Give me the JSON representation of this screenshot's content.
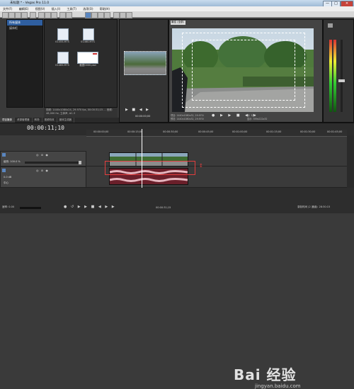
{
  "window": {
    "title": "未标题 * - Vegas Pro 11.0",
    "controls": [
      "—",
      "□",
      "✕"
    ]
  },
  "menu": [
    "文件(F)",
    "编辑(E)",
    "视图(V)",
    "插入(I)",
    "工具(T)",
    "选项(O)",
    "帮助(H)"
  ],
  "explorer": {
    "tree": [
      "所有媒体",
      "媒体柜"
    ],
    "files": [
      {
        "name": "01455.MTS"
      },
      {
        "name": "01460.MTS"
      },
      {
        "name": "01465.MTS"
      },
      {
        "name": "截图0000.psd"
      }
    ],
    "info": "视频: 1440x1080x24, 29.970 fps, 00:00:31;15 ... 音频: 48,000 Hz, 立体声, AC-3"
  },
  "tabs": [
    "项目媒体",
    "资源管理器",
    "转场",
    "视频特效",
    "媒体生成器"
  ],
  "preview": {
    "zoom": "最佳 (全部)",
    "project_info": "项目: 1440x1080x32, 29.970i\n预览: 1440x1080x32, 29.970i",
    "frame": "帧: 3/50",
    "display": "显示: 359x222x32"
  },
  "trimmer": {
    "timecode": "00:00:00;00"
  },
  "timeline": {
    "timecode": "00:00:11;10",
    "ruler": [
      "00:00:00;00",
      "00:00:15;00",
      "00:00:30;00",
      "00:00:45;00",
      "00:01:00;00",
      "00:01:15;00",
      "00:01:30;00",
      "00:01:45;00"
    ],
    "video_track": {
      "level": "级别: 100.0 %"
    },
    "audio_track": {
      "volume": "0.0 dB",
      "pan": "中心"
    }
  },
  "status": {
    "rate": "速率: 0.00",
    "record_time": "录制时间 (2 通道): 28:30:15",
    "end": "00:00:31;15"
  },
  "watermark": {
    "text": "Bai 经验",
    "url": "jingyan.baidu.com"
  },
  "colors": {
    "highlight": "#e23d3d",
    "accent": "#2f5fa0"
  }
}
